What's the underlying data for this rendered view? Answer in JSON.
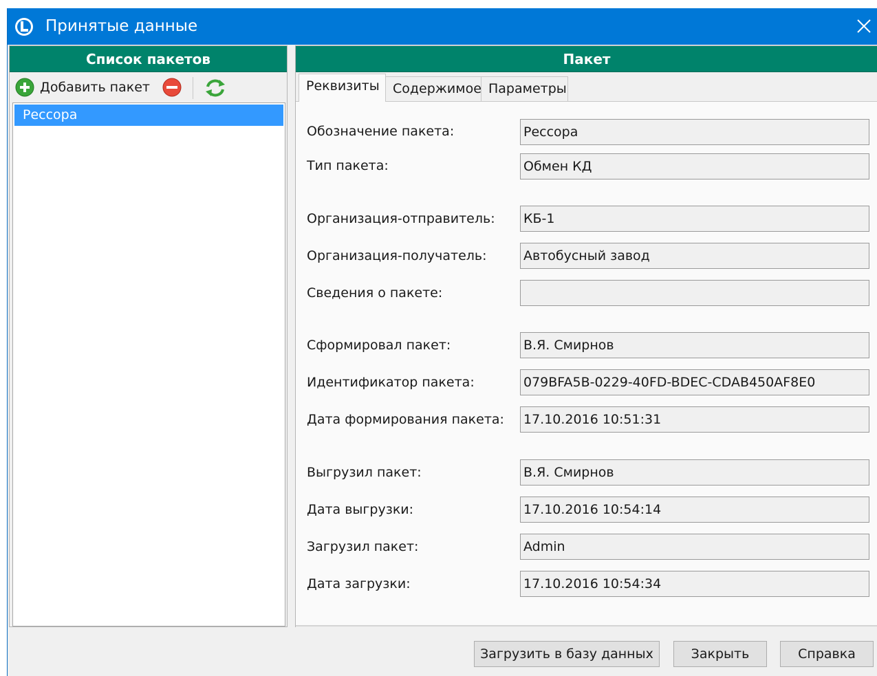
{
  "window": {
    "title": "Принятые данные"
  },
  "left": {
    "header": "Список пакетов",
    "add_label": "Добавить пакет",
    "items": [
      "Рессора"
    ]
  },
  "right": {
    "header": "Пакет",
    "tabs": [
      "Реквизиты",
      "Содержимое",
      "Параметры"
    ],
    "fields": [
      {
        "label": "Обозначение пакета:",
        "value": "Рессора"
      },
      {
        "label": "Тип пакета:",
        "value": "Обмен КД"
      },
      {
        "label": "Организация-отправитель:",
        "value": "КБ-1"
      },
      {
        "label": "Организация-получатель:",
        "value": "Автобусный завод"
      },
      {
        "label": "Сведения о пакете:",
        "value": ""
      },
      {
        "label": "Сформировал пакет:",
        "value": "В.Я. Смирнов"
      },
      {
        "label": "Идентификатор пакета:",
        "value": "079BFA5B-0229-40FD-BDEC-CDAB450AF8E0"
      },
      {
        "label": "Дата формирования пакета:",
        "value": "17.10.2016 10:51:31"
      },
      {
        "label": "Выгрузил пакет:",
        "value": "В.Я. Смирнов"
      },
      {
        "label": "Дата выгрузки:",
        "value": "17.10.2016 10:54:14"
      },
      {
        "label": "Загрузил пакет:",
        "value": "Admin"
      },
      {
        "label": "Дата загрузки:",
        "value": "17.10.2016 10:54:34"
      }
    ]
  },
  "buttons": {
    "load": "Загрузить в базу данных",
    "close": "Закрыть",
    "help": "Справка"
  },
  "colors": {
    "titlebar": "#0078d7",
    "panel_header": "#00836b",
    "selection": "#3399ff"
  }
}
